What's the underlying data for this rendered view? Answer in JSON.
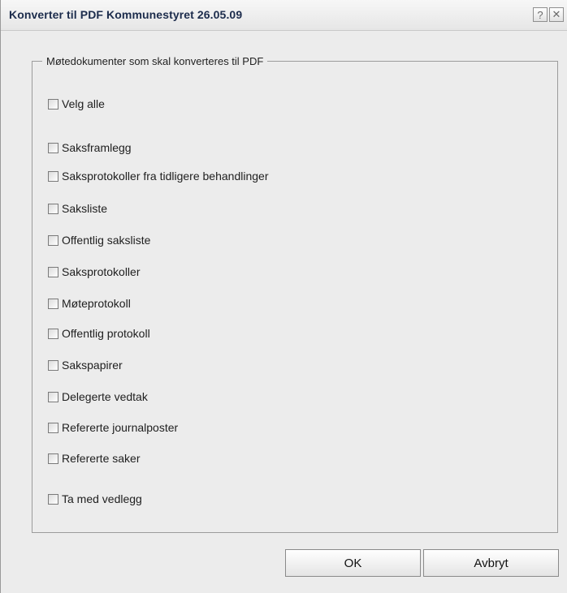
{
  "dialog": {
    "title": "Konverter til PDF Kommunestyret 26.05.09",
    "help_glyph": "?",
    "close_glyph": "✕"
  },
  "group": {
    "legend": "Møtedokumenter som skal konverteres til PDF",
    "select_all": {
      "label": "Velg alle",
      "checked": false
    },
    "items": [
      {
        "label": "Saksframlegg",
        "checked": false
      },
      {
        "label": "Saksprotokoller fra tidligere behandlinger",
        "checked": false
      },
      {
        "label": "Saksliste",
        "checked": false
      },
      {
        "label": "Offentlig saksliste",
        "checked": false
      },
      {
        "label": "Saksprotokoller",
        "checked": false
      },
      {
        "label": "Møteprotokoll",
        "checked": false
      },
      {
        "label": "Offentlig protokoll",
        "checked": false
      },
      {
        "label": "Sakspapirer",
        "checked": false
      },
      {
        "label": "Delegerte vedtak",
        "checked": false
      },
      {
        "label": "Refererte journalposter",
        "checked": false
      },
      {
        "label": "Refererte saker",
        "checked": false
      }
    ],
    "include_attachments": {
      "label": "Ta med vedlegg",
      "checked": false
    }
  },
  "buttons": {
    "ok_label": "OK",
    "cancel_label": "Avbryt"
  }
}
